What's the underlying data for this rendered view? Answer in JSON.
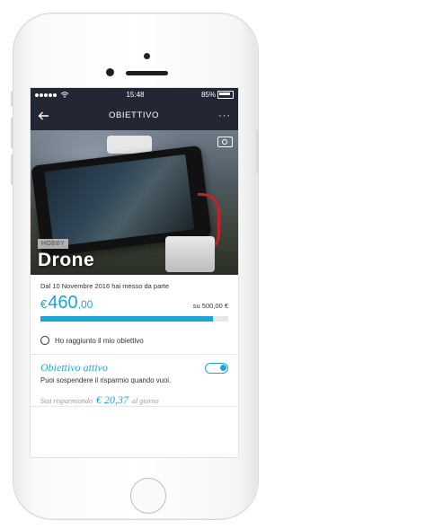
{
  "status": {
    "time": "15:48",
    "battery": "85%"
  },
  "nav": {
    "title": "OBIETTIVO",
    "more": "···"
  },
  "hero": {
    "badge": "HOBBY",
    "title": "Drone"
  },
  "savings": {
    "since_text": "Dal 10 Novembre 2016 hai messo da parte",
    "currency": "€",
    "amount_int": "460",
    "amount_dec": ",00",
    "goal_text": "su 500,00 €",
    "progress": 0.92
  },
  "reached": {
    "label": "Ho raggiunto il mio obiettivo",
    "checked": false
  },
  "active": {
    "title": "Obiettivo attivo",
    "description": "Puoi sospendere il risparmio quando vuoi.",
    "saving_prefix": "Stai risparmiando",
    "saving_value": "€ 20,37",
    "saving_suffix": "al giorno",
    "enabled": true
  },
  "colors": {
    "accent": "#1aa7d7",
    "navbar": "#232734"
  },
  "icons": [
    "back-arrow-icon",
    "more-icon",
    "camera-icon",
    "wifi-icon",
    "battery-icon"
  ]
}
